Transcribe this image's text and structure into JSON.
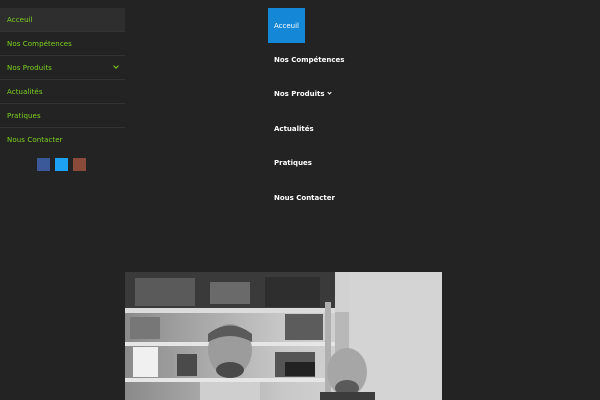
{
  "sidebar": {
    "items": [
      {
        "label": "Acceuil"
      },
      {
        "label": "Nos Compétences"
      },
      {
        "label": "Nos Produits"
      },
      {
        "label": "Actualités"
      },
      {
        "label": "Pratiques"
      },
      {
        "label": "Nous Contacter"
      }
    ]
  },
  "social": [
    {
      "icon": "facebook-icon",
      "color": "#3b5998"
    },
    {
      "icon": "twitter-icon",
      "color": "#1da1f2"
    },
    {
      "icon": "google-plus-icon",
      "color": "#8a4a3a"
    }
  ],
  "topmenu": {
    "active": "Acceuil",
    "items": [
      {
        "label": "Nos Compétences"
      },
      {
        "label": "Nos Produits"
      },
      {
        "label": "Actualités"
      },
      {
        "label": "Pratiques"
      },
      {
        "label": "Nous Contacter"
      }
    ]
  },
  "colors": {
    "background": "#232323",
    "accent_green": "#7ed321",
    "active_blue": "#1488d6"
  }
}
